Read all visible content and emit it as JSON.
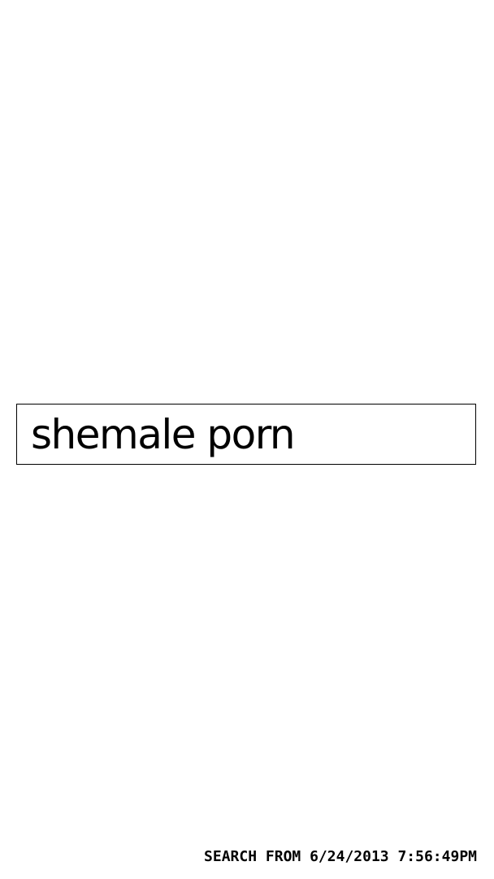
{
  "search": {
    "query": "shemale porn"
  },
  "footer": {
    "timestamp_label": "SEARCH FROM 6/24/2013 7:56:49PM"
  },
  "colors": {
    "background": "#ffffff",
    "text": "#000000",
    "border": "#000000"
  }
}
